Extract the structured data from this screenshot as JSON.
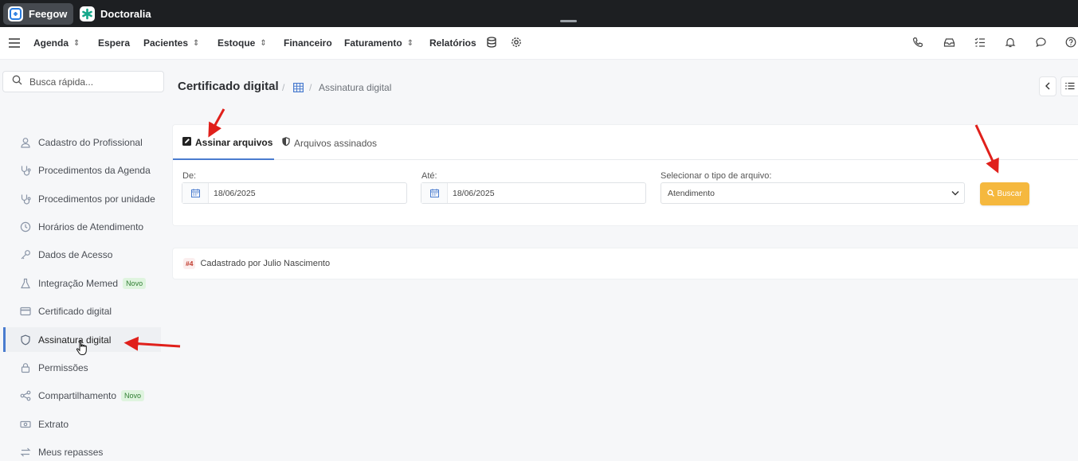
{
  "app_tabs": [
    {
      "label": "Feegow",
      "active": true
    },
    {
      "label": "Doctoralia",
      "active": false
    }
  ],
  "nav": {
    "items": [
      {
        "label": "Agenda",
        "dropdown": true
      },
      {
        "label": "Espera",
        "dropdown": false
      },
      {
        "label": "Pacientes",
        "dropdown": true
      },
      {
        "label": "Estoque",
        "dropdown": true
      },
      {
        "label": "Financeiro",
        "dropdown": false
      },
      {
        "label": "Faturamento",
        "dropdown": true
      },
      {
        "label": "Relatórios",
        "dropdown": false
      }
    ],
    "right_icons": [
      "phone-icon",
      "inbox-icon",
      "checklist-icon",
      "bell-icon",
      "chat-icon",
      "help-icon"
    ]
  },
  "sidebar": {
    "search_placeholder": "Busca rápida...",
    "items": [
      {
        "label": "Cadastro do Profissional",
        "icon": "user-icon"
      },
      {
        "label": "Procedimentos da Agenda",
        "icon": "stethoscope-icon"
      },
      {
        "label": "Procedimentos por unidade",
        "icon": "stethoscope-icon"
      },
      {
        "label": "Horários de Atendimento",
        "icon": "clock-icon"
      },
      {
        "label": "Dados de Acesso",
        "icon": "key-icon"
      },
      {
        "label": "Integração Memed",
        "icon": "flask-icon",
        "badge": "Novo"
      },
      {
        "label": "Certificado digital",
        "icon": "card-icon"
      },
      {
        "label": "Assinatura digital",
        "icon": "shield-icon",
        "active": true
      },
      {
        "label": "Permissões",
        "icon": "lock-icon"
      },
      {
        "label": "Compartilhamento",
        "icon": "share-icon",
        "badge": "Novo"
      },
      {
        "label": "Extrato",
        "icon": "money-icon"
      },
      {
        "label": "Meus repasses",
        "icon": "transfer-icon"
      }
    ]
  },
  "header": {
    "title": "Certificado digital",
    "breadcrumb": "Assinatura digital"
  },
  "tabs": [
    {
      "label": "Assinar arquivos",
      "active": true
    },
    {
      "label": "Arquivos assinados",
      "active": false
    }
  ],
  "filters": {
    "de_label": "De:",
    "de_value": "18/06/2025",
    "ate_label": "Até:",
    "ate_value": "18/06/2025",
    "tipo_label": "Selecionar o tipo de arquivo:",
    "tipo_value": "Atendimento",
    "buscar_label": "Buscar"
  },
  "record": {
    "number": "#4",
    "text": "Cadastrado por Julio Nascimento"
  },
  "colors": {
    "accent": "#4a7ccf",
    "buscar": "#f5b83e",
    "arrow": "#e0201b",
    "topbar": "#1d1f22"
  }
}
